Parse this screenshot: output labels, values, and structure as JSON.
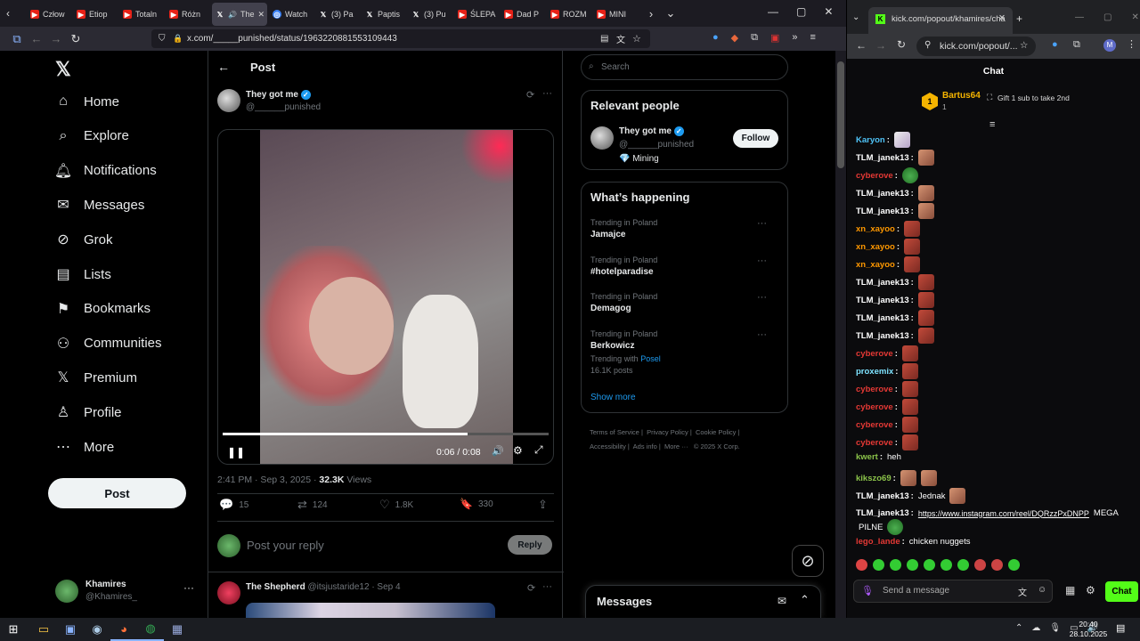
{
  "browser_left": {
    "tabs": [
      {
        "icon": "youtube-icon",
        "label": "Człow"
      },
      {
        "icon": "youtube-icon",
        "label": "Etiop"
      },
      {
        "icon": "youtube-icon",
        "label": "Totaln"
      },
      {
        "icon": "youtube-icon",
        "label": "Różn"
      },
      {
        "icon": "x-icon",
        "label": "The"
      },
      {
        "icon": "watch-icon",
        "label": "Watch"
      },
      {
        "icon": "x-icon",
        "label": "(3) Pa"
      },
      {
        "icon": "x-icon",
        "label": "Paptis"
      },
      {
        "icon": "x-icon",
        "label": "(3) Pu"
      },
      {
        "icon": "youtube-icon",
        "label": "ŚLEPA"
      },
      {
        "icon": "youtube-icon",
        "label": "Dad P"
      },
      {
        "icon": "youtube-icon",
        "label": "ROZM"
      },
      {
        "icon": "youtube-icon",
        "label": "MINI"
      }
    ],
    "url": "x.com/_____punished/status/1963220881553109443"
  },
  "x": {
    "nav": [
      {
        "label": "Home",
        "icon": "home-icon"
      },
      {
        "label": "Explore",
        "icon": "search-icon"
      },
      {
        "label": "Notifications",
        "icon": "bell-icon"
      },
      {
        "label": "Messages",
        "icon": "mail-icon"
      },
      {
        "label": "Grok",
        "icon": "grok-icon"
      },
      {
        "label": "Lists",
        "icon": "list-icon"
      },
      {
        "label": "Bookmarks",
        "icon": "bookmark-icon"
      },
      {
        "label": "Communities",
        "icon": "people-icon"
      },
      {
        "label": "Premium",
        "icon": "x-logo-icon"
      },
      {
        "label": "Profile",
        "icon": "person-icon"
      },
      {
        "label": "More",
        "icon": "more-circle-icon"
      }
    ],
    "post_button": "Post",
    "account": {
      "name": "Khamires",
      "handle": "@Khamires_"
    },
    "header_title": "Post",
    "post": {
      "author": "They got me",
      "handle": "@______punished",
      "video_time": "0:06 / 0:08",
      "video_progress": 0.75,
      "timestamp": "2:41 PM · Sep 3, 2025 ·",
      "views_count": "32.3K",
      "views_label": "Views",
      "replies": "15",
      "reposts": "124",
      "likes": "1.8K",
      "bookmarks": "330"
    },
    "reply_placeholder": "Post your reply",
    "reply_button": "Reply",
    "next_post": {
      "author": "The Shepherd",
      "handle": "@itsjustaride12 · Sep 4"
    },
    "search_placeholder": "Search",
    "relevant": {
      "title": "Relevant people",
      "name": "They got me",
      "handle": "@______punished",
      "bio": "💎 Mining",
      "follow": "Follow"
    },
    "happening": {
      "title": "What’s happening",
      "trends": [
        {
          "category": "Trending in Poland",
          "name": "Jamajce"
        },
        {
          "category": "Trending in Poland",
          "name": "#hotelparadise"
        },
        {
          "category": "Trending in Poland",
          "name": "Demagog"
        },
        {
          "category": "Trending in Poland",
          "name": "Berkowicz",
          "extra_prefix": "Trending with",
          "extra_link": "Posel",
          "posts": "16.1K posts"
        }
      ],
      "show_more": "Show more"
    },
    "footer": [
      "Terms of Service",
      "Privacy Policy",
      "Cookie Policy",
      "Accessibility",
      "Ads info",
      "More ···",
      "© 2025 X Corp."
    ],
    "messages_drawer": "Messages"
  },
  "browser_right": {
    "tab_title": "kick.com/popout/khamires/cha",
    "url": "kick.com/popout/...",
    "chat_title": "Chat",
    "pinned_user": "Bartus64",
    "pinned_count": "1",
    "pinned_text": "Gift 1 sub to take 2nd",
    "messages": [
      {
        "user": "Karyon",
        "color": "#4fc3f7",
        "text": "",
        "emotes": [
          "cat"
        ]
      },
      {
        "user": "TLM_janek13",
        "color": "#ffffff",
        "text": "",
        "emotes": [
          "face"
        ]
      },
      {
        "user": "cyberove",
        "color": "#e53935",
        "text": "",
        "emotes": [
          "frog"
        ]
      },
      {
        "user": "TLM_janek13",
        "color": "#ffffff",
        "text": "",
        "emotes": [
          "face"
        ]
      },
      {
        "user": "TLM_janek13",
        "color": "#ffffff",
        "text": "",
        "emotes": [
          "face"
        ]
      },
      {
        "user": "xn_xayoo",
        "color": "#ff9800",
        "text": "",
        "emotes": [
          "red"
        ]
      },
      {
        "user": "xn_xayoo",
        "color": "#ff9800",
        "text": "",
        "emotes": [
          "red"
        ]
      },
      {
        "user": "xn_xayoo",
        "color": "#ff9800",
        "text": "",
        "emotes": [
          "red"
        ]
      },
      {
        "user": "TLM_janek13",
        "color": "#ffffff",
        "text": "",
        "emotes": [
          "red"
        ]
      },
      {
        "user": "TLM_janek13",
        "color": "#ffffff",
        "text": "",
        "emotes": [
          "red"
        ]
      },
      {
        "user": "TLM_janek13",
        "color": "#ffffff",
        "text": "",
        "emotes": [
          "red"
        ]
      },
      {
        "user": "TLM_janek13",
        "color": "#ffffff",
        "text": "",
        "emotes": [
          "red"
        ]
      },
      {
        "user": "cyberove",
        "color": "#e53935",
        "text": "",
        "emotes": [
          "red"
        ]
      },
      {
        "user": "proxemix",
        "color": "#7ee3ff",
        "text": "",
        "emotes": [
          "red"
        ]
      },
      {
        "user": "cyberove",
        "color": "#e53935",
        "text": "",
        "emotes": [
          "red"
        ]
      },
      {
        "user": "cyberove",
        "color": "#e53935",
        "text": "",
        "emotes": [
          "red"
        ]
      },
      {
        "user": "cyberove",
        "color": "#e53935",
        "text": "",
        "emotes": [
          "red"
        ]
      },
      {
        "user": "cyberove",
        "color": "#e53935",
        "text": "",
        "emotes": [
          "red"
        ]
      },
      {
        "user": "kwert",
        "color": "#8bc34a",
        "text": "heh",
        "emotes": []
      },
      {
        "user": "kikszo69",
        "color": "#8bc34a",
        "text": "",
        "emotes": [
          "face",
          "face"
        ]
      },
      {
        "user": "TLM_janek13",
        "color": "#ffffff",
        "text": "Jednak",
        "emotes": [
          "face"
        ]
      },
      {
        "user": "TLM_janek13",
        "color": "#ffffff",
        "text": "https://www.instagram.com/reel/DQRzzPxDNPP",
        "text2": "MEGA",
        "emotes": []
      },
      {
        "user": "",
        "color": "#ffffff",
        "text": "PILNE",
        "emotes": [
          "frog"
        ]
      },
      {
        "user": "lego_lande",
        "color": "#e53935",
        "text": "chicken nuggets",
        "emotes": []
      }
    ],
    "send_placeholder": "Send a message",
    "chat_button": "Chat"
  },
  "taskbar": {
    "time": "20:40",
    "date": "28.10.2025"
  },
  "colors": {
    "x_blue": "#1d9bf0",
    "kick_green": "#53fc18"
  }
}
